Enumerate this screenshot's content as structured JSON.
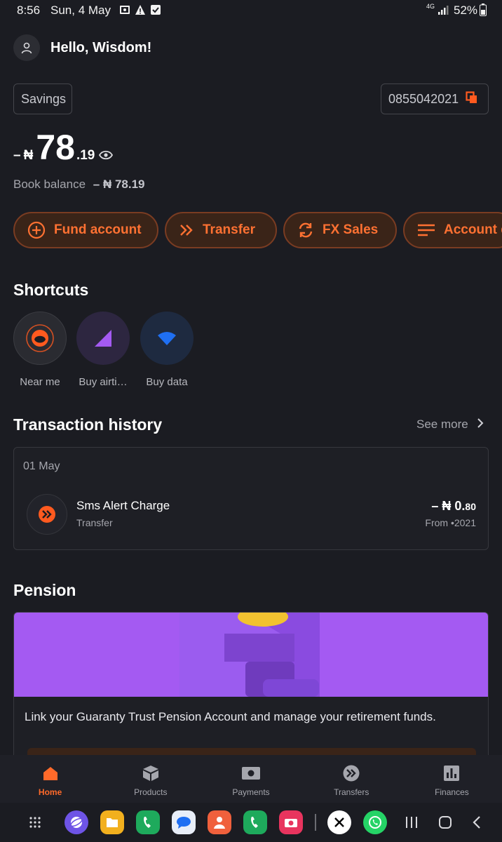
{
  "status_bar": {
    "time": "8:56",
    "date": "Sun, 4 May",
    "network": "4G",
    "battery": "52%"
  },
  "header": {
    "greeting": "Hello, Wisdom!"
  },
  "account": {
    "type": "Savings",
    "number": "0855042021",
    "balance_sign": "–",
    "currency": "₦",
    "balance_main": "78",
    "balance_decimal": ".19",
    "book_label": "Book balance",
    "book_value": "– ₦ 78.19"
  },
  "actions": [
    {
      "label": "Fund account",
      "icon": "plus-circle-icon"
    },
    {
      "label": "Transfer",
      "icon": "double-chevron-icon"
    },
    {
      "label": "FX Sales",
      "icon": "exchange-icon"
    },
    {
      "label": "Account d",
      "icon": "menu-icon"
    }
  ],
  "shortcuts": {
    "title": "Shortcuts",
    "items": [
      {
        "label": "Near me",
        "icon": "near-me-icon"
      },
      {
        "label": "Buy airti…",
        "icon": "airtime-signal-icon"
      },
      {
        "label": "Buy data",
        "icon": "wifi-icon"
      }
    ]
  },
  "transactions": {
    "title": "Transaction history",
    "see_more": "See more",
    "groups": [
      {
        "date": "01 May",
        "items": [
          {
            "name": "Sms Alert Charge",
            "type": "Transfer",
            "amount_main": "– ₦ 0.",
            "amount_decimal": "80",
            "from": "From •2021"
          }
        ]
      }
    ]
  },
  "pension": {
    "title": "Pension",
    "text": "Link your Guaranty Trust Pension Account and manage your retirement funds."
  },
  "bottom_nav": [
    {
      "label": "Home",
      "icon": "home-icon",
      "active": true
    },
    {
      "label": "Products",
      "icon": "box-icon",
      "active": false
    },
    {
      "label": "Payments",
      "icon": "cash-icon",
      "active": false
    },
    {
      "label": "Transfers",
      "icon": "transfer-icon",
      "active": false
    },
    {
      "label": "Finances",
      "icon": "chart-icon",
      "active": false
    }
  ],
  "colors": {
    "accent": "#ff6a2a",
    "background": "#1b1c22",
    "pension_banner": "#a45af2"
  }
}
